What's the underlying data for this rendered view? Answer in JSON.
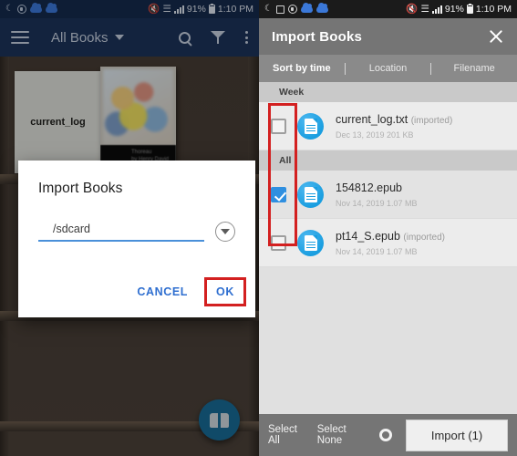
{
  "left": {
    "statusbar": {
      "icons": [
        "moon-icon",
        "screenshot-icon",
        "cloud-icon",
        "cloud-icon"
      ],
      "mute_icon": "mute-icon",
      "wifi_icon": "wifi-icon",
      "signal_icon": "signal-icon",
      "battery_percent": "91%",
      "time": "1:10 PM"
    },
    "toolbar": {
      "menu_icon": "hamburger-menu-icon",
      "title": "All Books",
      "dropdown_icon": "chevron-down-icon",
      "search_icon": "search-icon",
      "filter_icon": "filter-icon",
      "overflow_icon": "overflow-menu-icon"
    },
    "shelf": {
      "book1_label": "current_log",
      "book2_title": "Thoreau",
      "book2_author": "by Henry David"
    },
    "fab": {
      "icon": "open-book-icon"
    },
    "dialog": {
      "title": "Import Books",
      "input_value": "/sdcard",
      "input_placeholder": "/sdcard",
      "dropdown_icon": "dropdown-circle-icon",
      "cancel_label": "CANCEL",
      "ok_label": "OK"
    }
  },
  "right": {
    "statusbar": {
      "battery_percent": "91%",
      "time": "1:10 PM"
    },
    "header": {
      "title": "Import Books",
      "close_icon": "close-icon"
    },
    "tabs": [
      {
        "label": "Sort by time",
        "active": true
      },
      {
        "label": "Location",
        "active": false
      },
      {
        "label": "Filename",
        "active": false
      }
    ],
    "sections": [
      {
        "header": "Week",
        "files": [
          {
            "name": "current_log.txt",
            "suffix": "(imported)",
            "sub": "Dec 13, 2019 201 KB",
            "checked": false,
            "icon": "file-document-icon"
          }
        ]
      },
      {
        "header": "All",
        "files": [
          {
            "name": "154812.epub",
            "suffix": "",
            "sub": "Nov 14, 2019 1.07 MB",
            "checked": true,
            "icon": "file-document-icon"
          },
          {
            "name": "pt14_S.epub",
            "suffix": "(imported)",
            "sub": "Nov 14, 2019 1.07 MB",
            "checked": false,
            "icon": "file-document-icon"
          }
        ]
      }
    ],
    "bottom": {
      "select_all": "Select All",
      "select_none": "Select None",
      "settings_icon": "gear-icon",
      "import_label": "Import (1)"
    }
  },
  "annotations": {
    "highlight_color": "#d32020",
    "boxes": [
      "ok-button-highlight",
      "checkbox-column-highlight"
    ]
  }
}
